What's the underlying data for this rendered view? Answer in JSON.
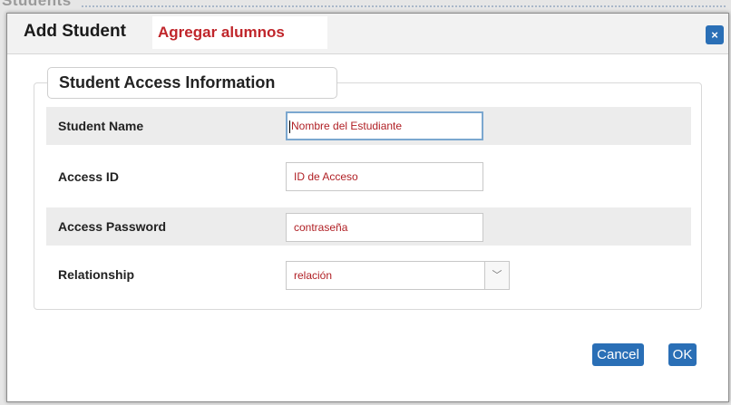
{
  "background": {
    "page_title": "Students"
  },
  "dialog": {
    "title": "Add Student",
    "title_translation": "Agregar alumnos",
    "close_label": "×",
    "section_title": "Student Access Information",
    "fields": {
      "student_name": {
        "label": "Student Name",
        "value": "Nombre del Estudiante",
        "focused": true
      },
      "access_id": {
        "label": "Access ID",
        "value": "ID de Acceso"
      },
      "access_password": {
        "label": "Access Password",
        "value": "contraseña"
      },
      "relationship": {
        "label": "Relationship",
        "value": "relación",
        "arrow": "﹀"
      }
    },
    "buttons": {
      "cancel": "Cancel",
      "ok": "OK"
    }
  },
  "colors": {
    "accent": "#2a6fb6",
    "translation_text": "#c0262b",
    "row_shade": "#ececec"
  },
  "icons": {
    "close": "close-icon",
    "dropdown": "chevron-down-icon"
  }
}
